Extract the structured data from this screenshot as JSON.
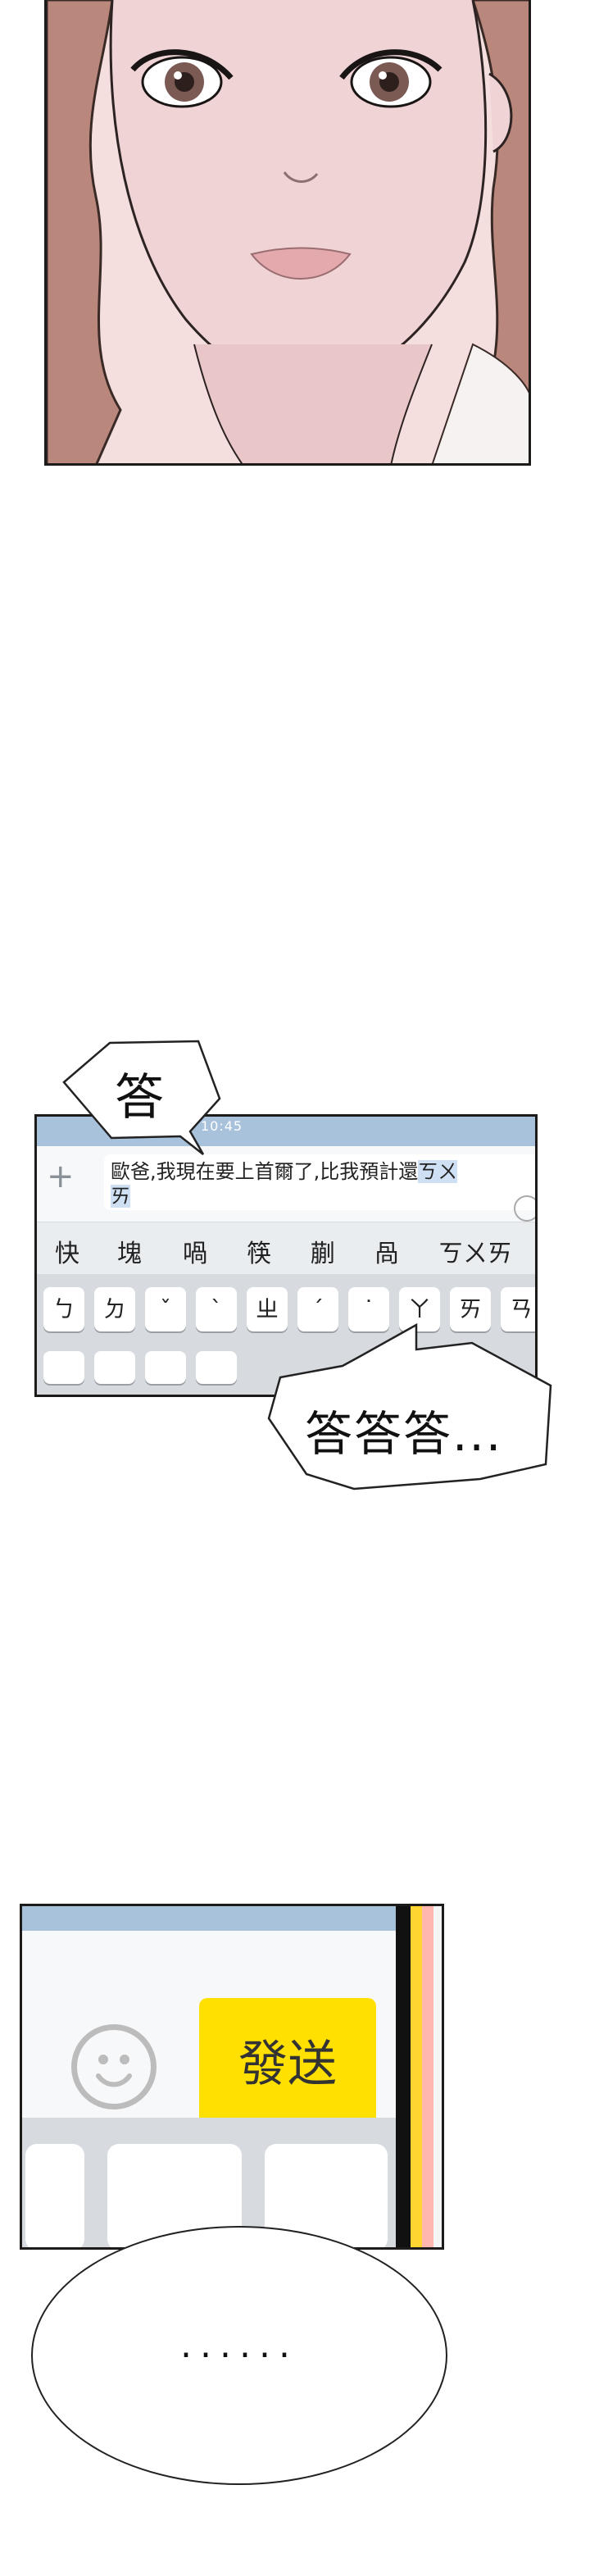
{
  "panel2": {
    "time": "10:45",
    "message_line1": "歐爸,我現在要上首爾了,比我預計還",
    "message_selected1": "ㄎㄨ",
    "message_selected2": "ㄞ",
    "candidates": [
      "快",
      "塊",
      "喎",
      "筷",
      "蒯",
      "咼",
      "ㄎㄨㄞ"
    ],
    "keys_row1": [
      "ㄅ",
      "ㄉ",
      "ˇ",
      "ˋ",
      "ㄓ",
      "ˊ",
      "˙",
      "ㄚ",
      "ㄞ",
      "ㄢ"
    ]
  },
  "bubbles": {
    "sfx_single": "答",
    "sfx_triple": "答答答..."
  },
  "panel3": {
    "send_label": "發送"
  },
  "ellipse_text": "......"
}
